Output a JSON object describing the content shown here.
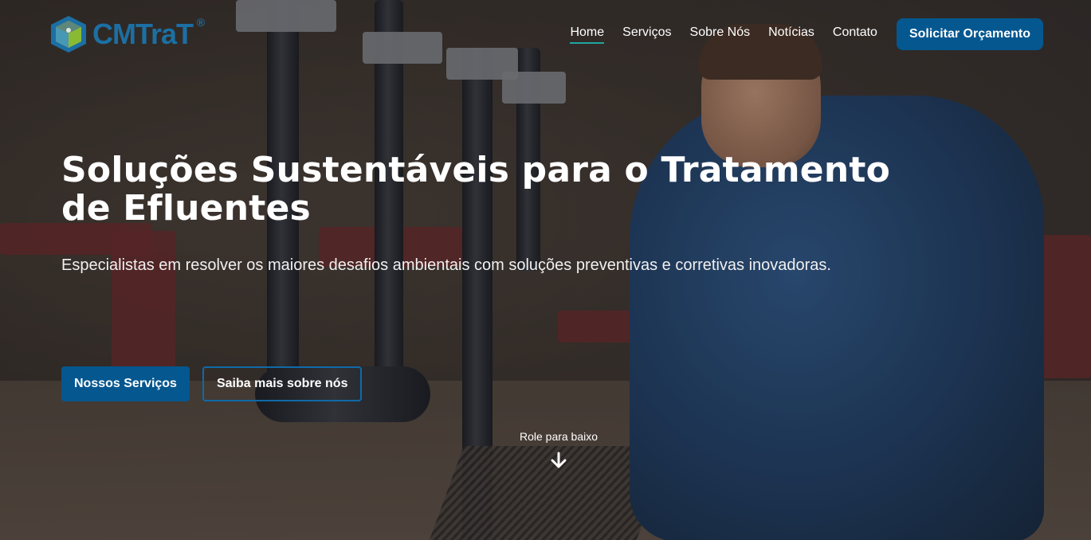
{
  "brand": {
    "logo_text": "CMTraT",
    "registered_mark": "®",
    "logo_icon": "cube-tank-icon",
    "colors": {
      "primary": "#05578f",
      "accent": "#1fa6a0",
      "logo_blue": "#1c6fa3",
      "logo_yellow": "#f2c01c"
    }
  },
  "nav": {
    "items": [
      {
        "label": "Home",
        "active": true
      },
      {
        "label": "Serviços",
        "active": false
      },
      {
        "label": "Sobre Nós",
        "active": false
      },
      {
        "label": "Notícias",
        "active": false
      },
      {
        "label": "Contato",
        "active": false
      }
    ],
    "cta_label": "Solicitar Orçamento"
  },
  "hero": {
    "title": "Soluções Sustentáveis para o Tratamento de Efluentes",
    "subtitle": "Especialistas em resolver os maiores desafios ambientais com soluções preventivas e corretivas inovadoras.",
    "primary_button": "Nossos Serviços",
    "secondary_button": "Saiba mais sobre nós",
    "scroll_label": "Role para baixo",
    "scroll_icon": "arrow-down-icon",
    "background_image": "plumber repairing pipes under sink in restaurant"
  }
}
